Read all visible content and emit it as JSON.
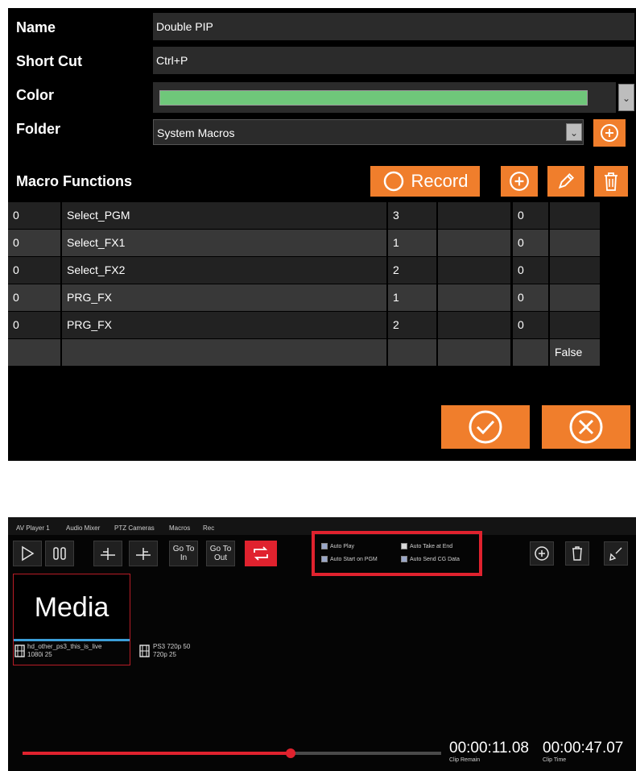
{
  "macro_editor": {
    "labels": {
      "name": "Name",
      "short_cut": "Short Cut",
      "color": "Color",
      "folder": "Folder",
      "macro_functions": "Macro Functions"
    },
    "name_value": "Double PIP",
    "shortcut_value": "Ctrl+P",
    "color_value": "#6fc77a",
    "folder_value": "System Macros",
    "record_label": "Record",
    "accent_color": "#f07e2c",
    "rows": [
      {
        "col1": "0",
        "col2": "Select_PGM",
        "col3": "3",
        "col4": "",
        "col5": "0",
        "col6": ""
      },
      {
        "col1": "0",
        "col2": "Select_FX1",
        "col3": "1",
        "col4": "",
        "col5": "0",
        "col6": ""
      },
      {
        "col1": "0",
        "col2": "Select_FX2",
        "col3": "2",
        "col4": "",
        "col5": "0",
        "col6": ""
      },
      {
        "col1": "0",
        "col2": "PRG_FX",
        "col3": "1",
        "col4": "",
        "col5": "0",
        "col6": ""
      },
      {
        "col1": "0",
        "col2": "PRG_FX",
        "col3": "2",
        "col4": "",
        "col5": "0",
        "col6": ""
      },
      {
        "col1": "",
        "col2": "",
        "col3": "",
        "col4": "",
        "col5": "",
        "col6": "False"
      }
    ]
  },
  "player": {
    "tabs": [
      "AV Player 1",
      "Audio Mixer",
      "PTZ Cameras",
      "Macros",
      "Rec"
    ],
    "go_to_in": "Go To In",
    "go_to_out": "Go To Out",
    "options": [
      {
        "label": "Auto Play",
        "checked": true
      },
      {
        "label": "Auto Take at End",
        "checked": false
      },
      {
        "label": "Auto Start on PGM",
        "checked": true
      },
      {
        "label": "Auto Send CG Data",
        "checked": true
      }
    ],
    "media_label": "Media",
    "clips": [
      {
        "name": "hd_other_ps3_this_is_live",
        "format": "1080i 25"
      },
      {
        "name": "PS3 720p 50",
        "format": "720p 25"
      }
    ],
    "progress": 0.64,
    "clip_remain": "00:00:11.08",
    "clip_remain_label": "Clip Remain",
    "clip_time": "00:00:47.07",
    "clip_time_label": "Clip Time",
    "highlight_color": "#e0222e"
  }
}
